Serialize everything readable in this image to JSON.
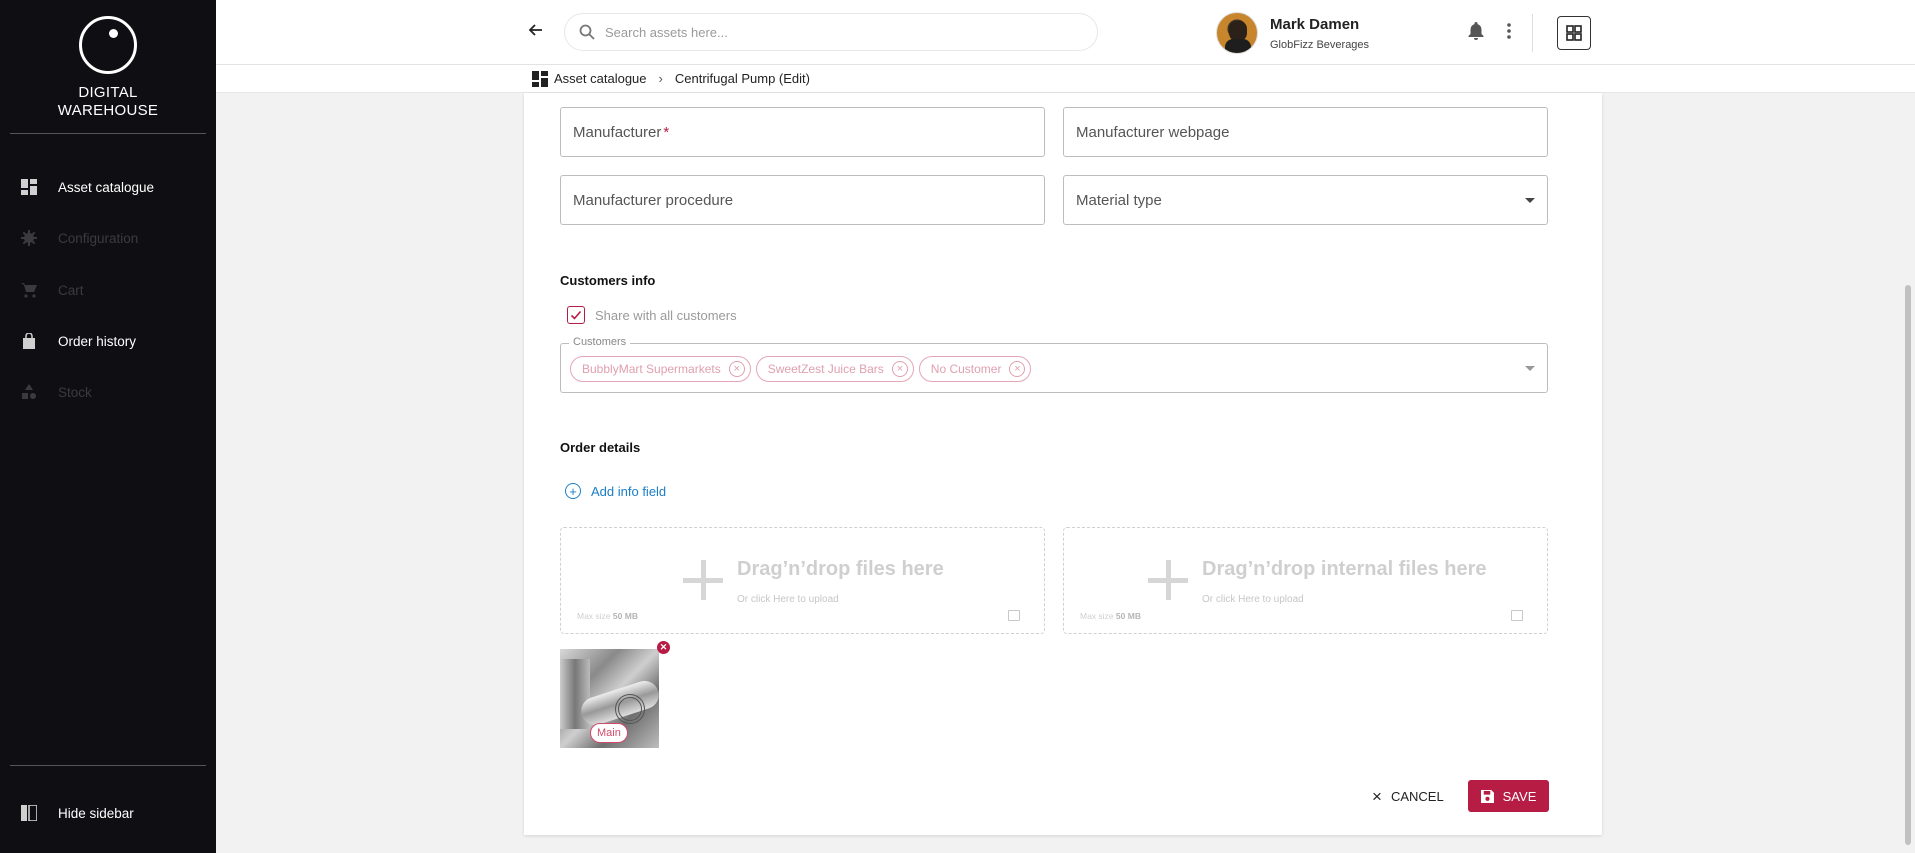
{
  "sidebar": {
    "brand_line1": "DIGITAL",
    "brand_line2": "WAREHOUSE",
    "items": [
      {
        "label": "Asset catalogue",
        "icon": "dashboard-icon",
        "state": "active"
      },
      {
        "label": "Configuration",
        "icon": "gear-icon",
        "state": "disabled"
      },
      {
        "label": "Cart",
        "icon": "cart-icon",
        "state": "disabled"
      },
      {
        "label": "Order history",
        "icon": "shopping-bag-icon",
        "state": "active"
      },
      {
        "label": "Stock",
        "icon": "shapes-icon",
        "state": "disabled"
      }
    ],
    "hide_label": "Hide sidebar"
  },
  "header": {
    "search_placeholder": "Search assets here...",
    "user_name": "Mark Damen",
    "user_org": "GlobFizz Beverages"
  },
  "breadcrumb": {
    "home": "Asset catalogue",
    "current": "Centrifugal Pump (Edit)"
  },
  "form": {
    "manufacturer": "Manufacturer",
    "manufacturer_required": "*",
    "manufacturer_webpage": "Manufacturer webpage",
    "manufacturer_procedure": "Manufacturer procedure",
    "material_type": "Material type",
    "customers_section": "Customers info",
    "share_all_label": "Share with all customers",
    "share_all_checked": true,
    "customers_legend": "Customers",
    "customers": [
      "BubblyMart Supermarkets",
      "SweetZest Juice Bars",
      "No Customer"
    ],
    "order_section": "Order details",
    "add_info_label": "Add info field",
    "dropzone_files": {
      "title": "Drag’n’drop files here",
      "subtitle": "Or click Here to upload",
      "max_label": "Max size",
      "max_value": "50 MB"
    },
    "dropzone_internal": {
      "title": "Drag’n’drop internal files here",
      "subtitle": "Or click Here to upload",
      "max_label": "Max size",
      "max_value": "50 MB"
    },
    "main_badge": "Main",
    "cancel_label": "CANCEL",
    "save_label": "SAVE"
  },
  "colors": {
    "accent": "#b71c45",
    "link": "#1a7ec8",
    "sidebar_bg": "#0f0f13"
  }
}
